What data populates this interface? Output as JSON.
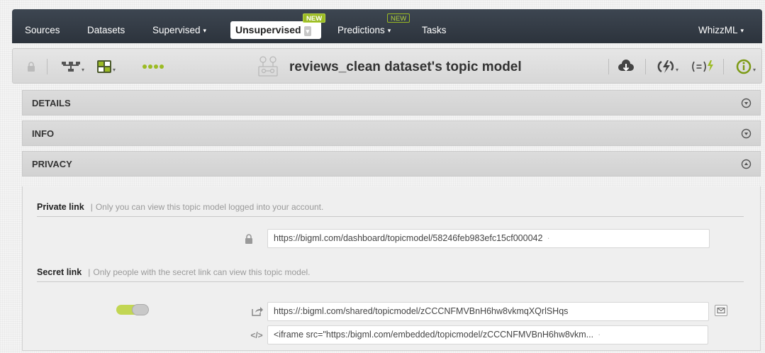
{
  "nav": {
    "items": [
      {
        "label": "Sources"
      },
      {
        "label": "Datasets"
      },
      {
        "label": "Supervised",
        "caret": "▾"
      },
      {
        "label": "Unsupervised",
        "caret": "▾",
        "badge": "NEW",
        "active": true
      },
      {
        "label": "Predictions",
        "caret": "▾",
        "badge": "NEW"
      },
      {
        "label": "Tasks"
      }
    ],
    "right": {
      "label": "WhizzML",
      "caret": "▾"
    }
  },
  "toolbar": {
    "title": "reviews_clean dataset's topic model",
    "icons": [
      "lock-icon",
      "tree-view-icon",
      "numbers-view-icon",
      "dots-icon",
      "topic-model-icon",
      "cloud-download-icon",
      "lightning-actions-icon",
      "batch-prediction-icon",
      "info-icon"
    ],
    "accent": "#9bbb23"
  },
  "sections": {
    "details": "DETAILS",
    "info": "INFO",
    "privacy": "PRIVACY"
  },
  "privacy": {
    "private_label": "Private link",
    "private_desc": "Only you can view this topic model logged into your account.",
    "private_url": "https://bigml.com/dashboard/topicmodel/58246feb983efc15cf000042",
    "secret_label": "Secret link",
    "secret_desc": "Only people with the secret link can view this topic model.",
    "secret_url": "https://:bigml.com/shared/topicmodel/zCCCNFMVBnH6hw8vkmqXQrlSHqs",
    "embed_code": "<iframe src=\"https:/bigml.com/embedded/topicmodel/zCCCNFMVBnH6hw8vkm...",
    "bar": "|",
    "cursor": "·",
    "secret_enabled": true
  }
}
